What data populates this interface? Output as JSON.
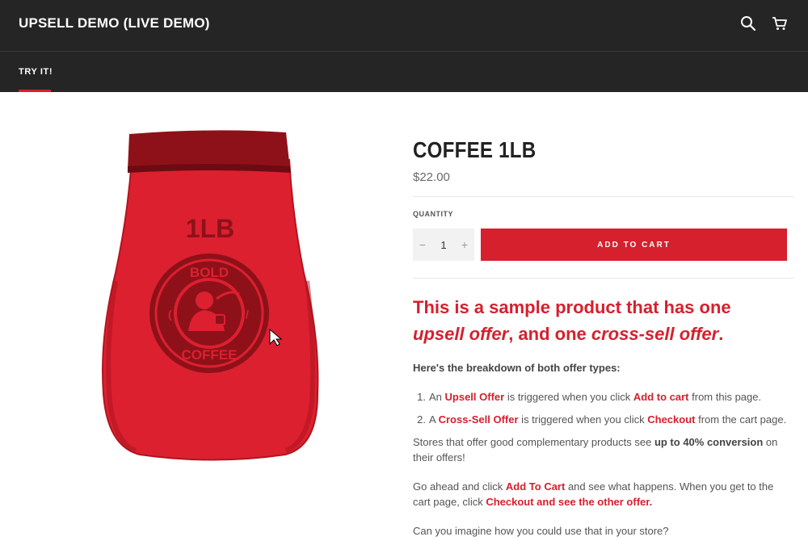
{
  "header": {
    "site_title": "UPSELL DEMO (LIVE DEMO)",
    "icons": [
      "search-icon",
      "cart-icon"
    ]
  },
  "nav": {
    "items": [
      {
        "label": "TRY IT!",
        "active": true
      }
    ]
  },
  "product": {
    "image_text_weight": "1LB",
    "image_text_brand_top": "BOLD",
    "image_text_brand_bottom": "COFFEE",
    "title": "COFFEE 1LB",
    "price": "$22.00",
    "quantity_label": "QUANTITY",
    "quantity_minus": "−",
    "quantity_value": "1",
    "quantity_plus": "+",
    "add_to_cart": "ADD TO CART"
  },
  "description": {
    "promo_part1": "This is a sample product that has one",
    "promo_upsell": "upsell offer",
    "promo_part2": ", and one ",
    "promo_cross": "cross-sell offer",
    "promo_part3": ".",
    "breakdown_heading": "Here's the breakdown of both offer types:",
    "list": [
      {
        "num": "1.",
        "pre": "An ",
        "offer": "Upsell Offer",
        "mid": " is triggered when you click ",
        "action": "Add to cart",
        "post": " from this page."
      },
      {
        "num": "2.",
        "pre": "A ",
        "offer": "Cross-Sell Offer",
        "mid": " is triggered when you click ",
        "action": "Checkout",
        "post": " from the cart page."
      }
    ],
    "stores_pre": "Stores that offer good complementary products see ",
    "stores_bold": "up to 40% conversion",
    "stores_post": " on their offers!",
    "goahead_pre": "Go ahead and click ",
    "goahead_link1": "Add To Cart",
    "goahead_mid": " and see what happens. When you get to the cart page, click ",
    "goahead_link2": "Checkout and see the other offer.",
    "imagine": "Can you imagine how you could use that in your store?"
  },
  "colors": {
    "accent": "#d6202e",
    "header_bg": "#252525",
    "bag_red": "#dc2030",
    "bag_dark": "#8e1119"
  }
}
